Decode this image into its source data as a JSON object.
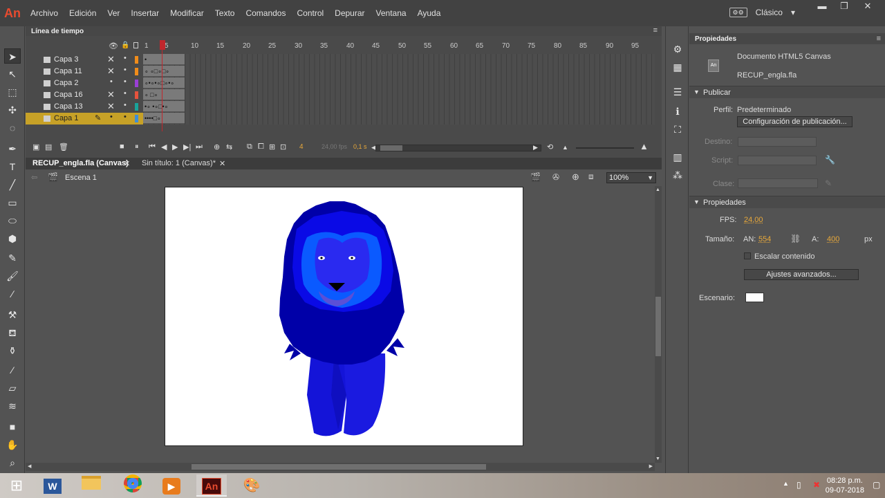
{
  "app": {
    "logo": "An"
  },
  "menu": [
    "Archivo",
    "Edición",
    "Ver",
    "Insertar",
    "Modificar",
    "Texto",
    "Comandos",
    "Control",
    "Depurar",
    "Ventana",
    "Ayuda"
  ],
  "workspace": {
    "label": "Clásico",
    "caret": "▾"
  },
  "window_controls": {
    "minimize": "▬",
    "restore": "❐",
    "close": "✕"
  },
  "timeline": {
    "tab": "Línea de tiempo",
    "ruler": [
      "1",
      "5",
      "10",
      "15",
      "20",
      "25",
      "30",
      "35",
      "40",
      "45",
      "50",
      "55",
      "60",
      "65",
      "70",
      "75",
      "80",
      "85",
      "90",
      "95"
    ],
    "layers": [
      {
        "name": "Capa 3",
        "color": "#f08c1a",
        "frames": "•"
      },
      {
        "name": "Capa 11",
        "color": "#f08c1a",
        "frames": "∘  ∘□∘□∘"
      },
      {
        "name": "Capa 2",
        "color": "#9a3fd6",
        "frames": "∘•∘•∘□∘•∘"
      },
      {
        "name": "Capa 16",
        "color": "#e5533d",
        "frames": "∘          □∘"
      },
      {
        "name": "Capa 13",
        "color": "#19a39a",
        "frames": "•∘ •∘□•∘"
      },
      {
        "name": "Capa 1",
        "color": "#3e8fd6",
        "frames": "••••□∘"
      }
    ],
    "current_frame": "4",
    "fps": "24,00 fps",
    "time": "0,1 s"
  },
  "document_tabs": [
    {
      "label": "RECUP_engla.fla (Canvas)",
      "close": "✕"
    },
    {
      "label": "Sin título: 1 (Canvas)*",
      "close": "✕"
    }
  ],
  "scene": {
    "label": "Escena 1",
    "zoom": "100%"
  },
  "properties": {
    "tab": "Propiedades",
    "doc_type": "Documento HTML5 Canvas",
    "doc_icon": "An",
    "file_name": "RECUP_engla.fla",
    "publish": {
      "title": "Publicar",
      "profile_label": "Perfil:",
      "profile_value": "Predeterminado",
      "config_button": "Configuración de publicación...",
      "target_label": "Destino:",
      "script_label": "Script:",
      "class_label": "Clase:"
    },
    "props_section": {
      "title": "Propiedades",
      "fps_label": "FPS:",
      "fps_value": "24,00",
      "size_label": "Tamaño:",
      "width_label": "AN:",
      "width_value": "554",
      "height_label": "A:",
      "height_value": "400",
      "unit": "px",
      "scale_label": "Escalar contenido",
      "advanced_button": "Ajustes avanzados...",
      "stage_label": "Escenario:",
      "stage_color": "#ffffff"
    }
  },
  "taskbar": {
    "time": "08:28 p.m.",
    "date": "09-07-2018"
  }
}
